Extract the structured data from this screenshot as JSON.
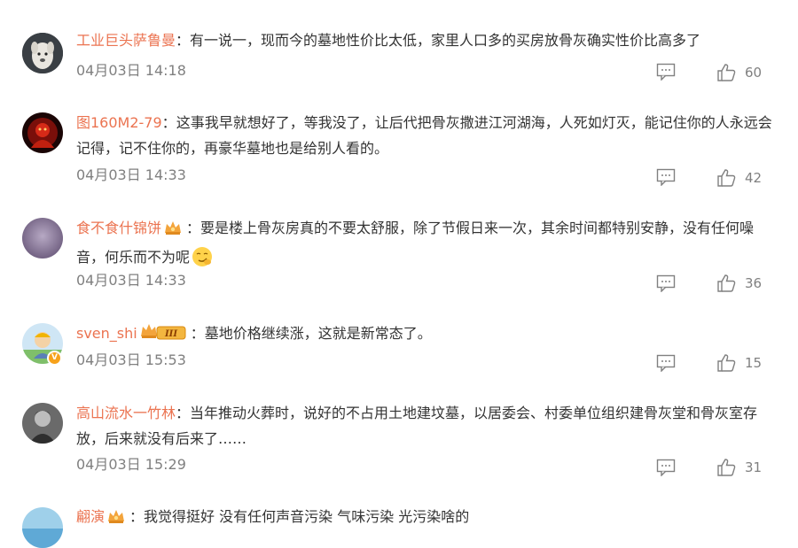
{
  "comments": [
    {
      "username": "工业巨头萨鲁曼",
      "text": "有一说一，现而今的墓地性价比太低，家里人口多的买房放骨灰确实性价比高多了",
      "time": "04月03日 14:18",
      "likes": "60",
      "avatar_icon": "white-dog-avatar"
    },
    {
      "username": "图160M2-79",
      "text": "这事我早就想好了，等我没了，让后代把骨灰撒进江河湖海，人死如灯灭，能记住你的人永远会记得，记不住你的，再豪华墓地也是给别人看的。",
      "time": "04月03日 14:33",
      "likes": "42",
      "avatar_icon": "red-figure-avatar"
    },
    {
      "username": "食不食什锦饼",
      "text": "要是楼上骨灰房真的不要太舒服，除了节假日来一次，其余时间都特别安静，没有任何噪音，何乐而不为呢",
      "time": "04月03日 14:33",
      "likes": "36",
      "avatar_icon": "purple-blur-avatar",
      "badge_icon": "crown-badge-icon",
      "emoji_icon": "smirk-emoji-icon"
    },
    {
      "username": "sven_shi",
      "text": "墓地价格继续涨，这就是新常态了。",
      "time": "04月03日 15:53",
      "likes": "15",
      "avatar_icon": "cartoon-person-avatar",
      "badge_icon": "crown-level-badge-icon",
      "badge_text": "III",
      "verified_icon": "verified-v-icon",
      "verified_text": "V"
    },
    {
      "username": "高山流水一竹林",
      "text": "当年推动火葬时，说好的不占用土地建坟墓，以居委会、村委单位组织建骨灰堂和骨灰室存放，后来就没有后来了……",
      "time": "04月03日 15:29",
      "likes": "31",
      "avatar_icon": "bw-portrait-avatar"
    },
    {
      "username": "翩演",
      "text": "我觉得挺好 没有任何声音污染 气味污染 光污染啥的",
      "avatar_icon": "blue-sky-avatar",
      "badge_icon": "crown-badge-icon"
    }
  ],
  "separator": "：",
  "reply_icon": "comment-icon",
  "like_icon": "thumbs-up-icon",
  "colors": {
    "username": "#eb7350",
    "body_text": "#333333",
    "meta_text": "#808080",
    "badge_gold": "#f7a21b"
  }
}
